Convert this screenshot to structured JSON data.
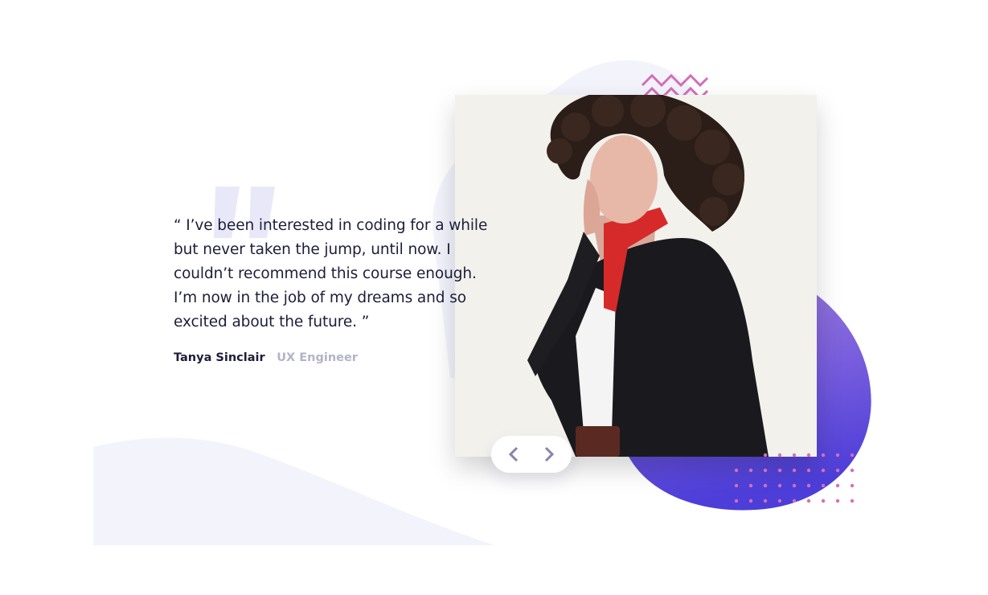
{
  "testimonial": {
    "quote": "“ I’ve been interested in coding for a while but never taken the jump, until now. I couldn’t recommend this course enough. I’m now in the job of my dreams and so excited about the future. ”",
    "author_name": "Tanya Sinclair",
    "author_role": "UX Engineer"
  },
  "icons": {
    "quote_mark": "quote-mark-icon",
    "previous": "chevron-left-icon",
    "next": "chevron-right-icon",
    "zigzag": "zigzag-pattern",
    "dots": "dot-grid-pattern"
  },
  "colors": {
    "text_dark": "#1d1d3a",
    "text_muted": "#b3b3c8",
    "accent_purple": "#6b5ce8",
    "blob_light": "#f3f3fc",
    "pattern_pink": "#d36fb9",
    "chevron": "#8585ac"
  }
}
